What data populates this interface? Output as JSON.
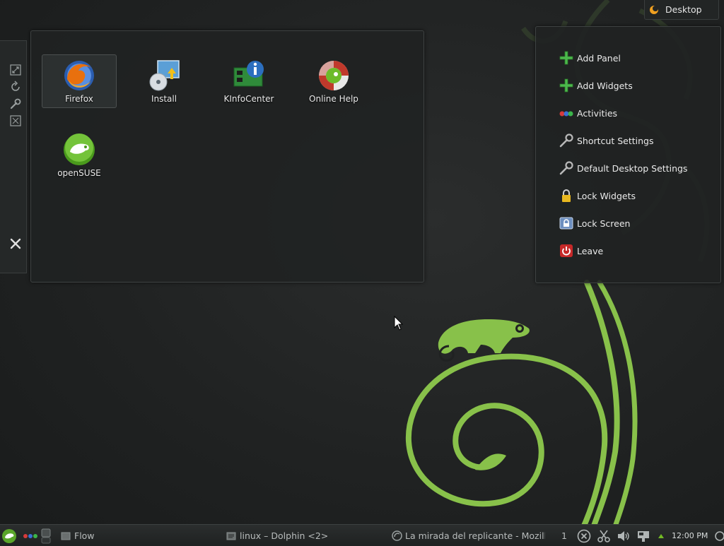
{
  "desktop_icons": [
    {
      "label": "Firefox",
      "icon": "firefox-icon"
    },
    {
      "label": "Install",
      "icon": "install-icon"
    },
    {
      "label": "KInfoCenter",
      "icon": "kinfocenter-icon"
    },
    {
      "label": "Online Help",
      "icon": "online-help-icon"
    },
    {
      "label": "openSUSE",
      "icon": "opensuse-icon"
    }
  ],
  "toolbox": {
    "label": "Desktop",
    "icon": "plasma-toolbox-icon"
  },
  "context_menu": [
    {
      "label": "Add Panel",
      "icon": "add-icon"
    },
    {
      "label": "Add Widgets",
      "icon": "add-icon"
    },
    {
      "label": "Activities",
      "icon": "activities-icon"
    },
    {
      "label": "Shortcut Settings",
      "icon": "wrench-icon"
    },
    {
      "label": "Default Desktop Settings",
      "icon": "wrench-icon"
    },
    {
      "label": "Lock Widgets",
      "icon": "padlock-icon"
    },
    {
      "label": "Lock Screen",
      "icon": "lock-screen-icon"
    },
    {
      "label": "Leave",
      "icon": "power-icon"
    }
  ],
  "handle_tools": [
    "resize-icon",
    "rotate-icon",
    "wrench-icon",
    "fullscreen-icon",
    "close-icon"
  ],
  "taskbar": {
    "tasks": [
      {
        "label": "Flow",
        "icon": "folder-icon"
      },
      {
        "label": "linux – Dolphin <2>",
        "icon": "dolphin-icon"
      },
      {
        "label": "La mirada del replicante - Mozilla",
        "icon": "firefox-icon"
      }
    ],
    "pager_number": "1",
    "clock": "12:00 PM"
  },
  "colors": {
    "accent_green": "#73ba25",
    "background": "#202222",
    "menu_bg": "#202222",
    "text": "#e6e6e6"
  }
}
